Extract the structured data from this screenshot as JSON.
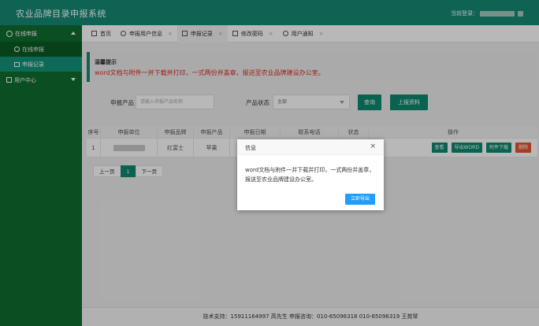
{
  "header": {
    "title": "农业品牌目录申报系统",
    "login_label": "当前登录："
  },
  "sidebar": {
    "groups": [
      {
        "label": "在线申报",
        "icon": "gear-icon",
        "expanded": true,
        "items": [
          {
            "label": "在线申报",
            "icon": "circle-icon",
            "active": false
          },
          {
            "label": "申报记录",
            "icon": "list-icon",
            "active": true
          }
        ]
      },
      {
        "label": "用户中心",
        "icon": "edit-icon",
        "expanded": false
      }
    ]
  },
  "tabs": [
    {
      "label": "首页",
      "icon": "monitor-icon",
      "closable": false,
      "active": false
    },
    {
      "label": "申报用户信息",
      "icon": "info-icon",
      "closable": true,
      "active": false
    },
    {
      "label": "申报记录",
      "icon": "document-icon",
      "closable": true,
      "active": true
    },
    {
      "label": "修改密码",
      "icon": "edit-icon",
      "closable": true,
      "active": false
    },
    {
      "label": "用户通知",
      "icon": "bell-icon",
      "closable": true,
      "active": false
    }
  ],
  "tab_close_glyph": "×",
  "tip": {
    "title": "温馨提示",
    "text": "word文档与附件一并下载并打印，一式两份并盖章，报送至农业品牌建设办公室。"
  },
  "search": {
    "product_label": "申报产品",
    "product_placeholder": "请输入申报产品名称",
    "status_label": "产品状态",
    "status_value": "全部",
    "query_button": "查询",
    "upload_button": "上报资料"
  },
  "table": {
    "headers": [
      "序号",
      "申报单位",
      "申报品牌",
      "申报产品",
      "申报日期",
      "联系电话",
      "状态",
      "操作"
    ],
    "rows": [
      {
        "index": "1",
        "brand": "红富士",
        "product": "苹果",
        "actions": [
          "查看",
          "导出WORD",
          "附件下载",
          "删除"
        ]
      }
    ]
  },
  "pager": {
    "prev": "上一页",
    "current": "1",
    "next": "下一页"
  },
  "dialog": {
    "title": "信息",
    "close": "×",
    "body": "word文档与附件一并下载并打印，一式两份并盖章，报送至农业品牌建设办公室。",
    "confirm": "立即导出"
  },
  "footer": {
    "text": "技术支持：15911164997   高先生   申报咨询：010-65096318   010-65096319   王苑琴"
  },
  "colors": {
    "header": "#148a73",
    "sidebar": "#0e6d2e",
    "accent": "#0f8a6f",
    "danger": "#e8552c",
    "dialog_button": "#1e9fff",
    "tip_text": "#e02b20"
  }
}
